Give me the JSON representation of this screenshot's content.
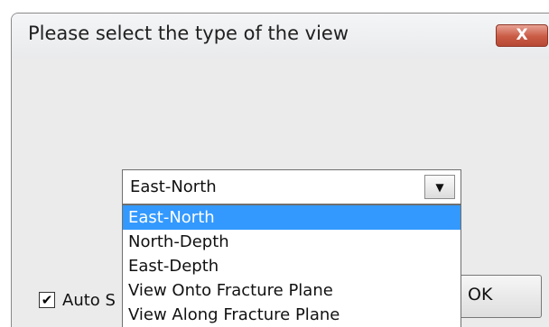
{
  "dialog": {
    "title": "Please select the type of the view",
    "close_label": "X"
  },
  "view_type": {
    "selected_value": "East-North",
    "options": [
      "East-North",
      "North-Depth",
      "East-Depth",
      "View Onto Fracture Plane",
      "View Along Fracture Plane"
    ],
    "highlighted_option": "East-North"
  },
  "auto_checkbox": {
    "label": "Auto S",
    "checked": true,
    "check_glyph": "✔"
  },
  "ok_button": {
    "label": "OK"
  },
  "colors": {
    "highlight": "#3399ff",
    "close_button": "#c95b45"
  }
}
